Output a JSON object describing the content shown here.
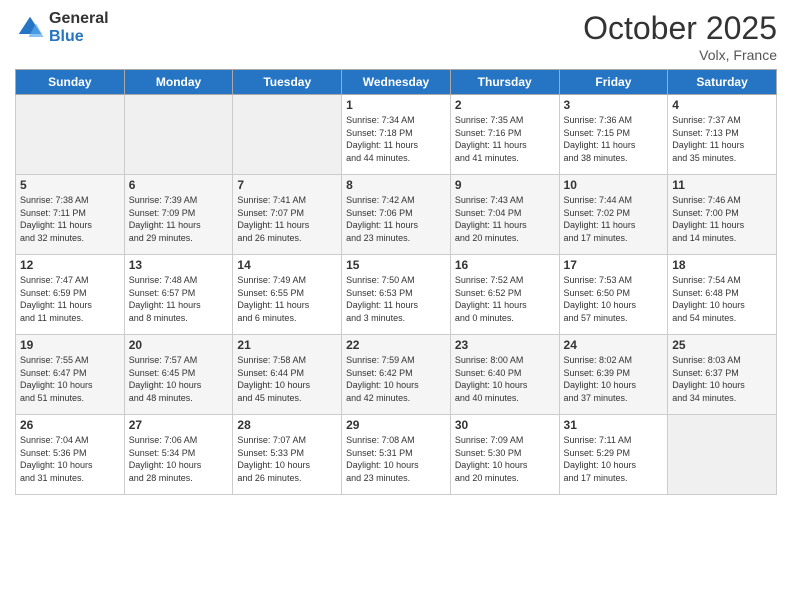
{
  "logo": {
    "general": "General",
    "blue": "Blue"
  },
  "title": "October 2025",
  "subtitle": "Volx, France",
  "weekdays": [
    "Sunday",
    "Monday",
    "Tuesday",
    "Wednesday",
    "Thursday",
    "Friday",
    "Saturday"
  ],
  "weeks": [
    [
      {
        "day": "",
        "info": ""
      },
      {
        "day": "",
        "info": ""
      },
      {
        "day": "",
        "info": ""
      },
      {
        "day": "1",
        "info": "Sunrise: 7:34 AM\nSunset: 7:18 PM\nDaylight: 11 hours\nand 44 minutes."
      },
      {
        "day": "2",
        "info": "Sunrise: 7:35 AM\nSunset: 7:16 PM\nDaylight: 11 hours\nand 41 minutes."
      },
      {
        "day": "3",
        "info": "Sunrise: 7:36 AM\nSunset: 7:15 PM\nDaylight: 11 hours\nand 38 minutes."
      },
      {
        "day": "4",
        "info": "Sunrise: 7:37 AM\nSunset: 7:13 PM\nDaylight: 11 hours\nand 35 minutes."
      }
    ],
    [
      {
        "day": "5",
        "info": "Sunrise: 7:38 AM\nSunset: 7:11 PM\nDaylight: 11 hours\nand 32 minutes."
      },
      {
        "day": "6",
        "info": "Sunrise: 7:39 AM\nSunset: 7:09 PM\nDaylight: 11 hours\nand 29 minutes."
      },
      {
        "day": "7",
        "info": "Sunrise: 7:41 AM\nSunset: 7:07 PM\nDaylight: 11 hours\nand 26 minutes."
      },
      {
        "day": "8",
        "info": "Sunrise: 7:42 AM\nSunset: 7:06 PM\nDaylight: 11 hours\nand 23 minutes."
      },
      {
        "day": "9",
        "info": "Sunrise: 7:43 AM\nSunset: 7:04 PM\nDaylight: 11 hours\nand 20 minutes."
      },
      {
        "day": "10",
        "info": "Sunrise: 7:44 AM\nSunset: 7:02 PM\nDaylight: 11 hours\nand 17 minutes."
      },
      {
        "day": "11",
        "info": "Sunrise: 7:46 AM\nSunset: 7:00 PM\nDaylight: 11 hours\nand 14 minutes."
      }
    ],
    [
      {
        "day": "12",
        "info": "Sunrise: 7:47 AM\nSunset: 6:59 PM\nDaylight: 11 hours\nand 11 minutes."
      },
      {
        "day": "13",
        "info": "Sunrise: 7:48 AM\nSunset: 6:57 PM\nDaylight: 11 hours\nand 8 minutes."
      },
      {
        "day": "14",
        "info": "Sunrise: 7:49 AM\nSunset: 6:55 PM\nDaylight: 11 hours\nand 6 minutes."
      },
      {
        "day": "15",
        "info": "Sunrise: 7:50 AM\nSunset: 6:53 PM\nDaylight: 11 hours\nand 3 minutes."
      },
      {
        "day": "16",
        "info": "Sunrise: 7:52 AM\nSunset: 6:52 PM\nDaylight: 11 hours\nand 0 minutes."
      },
      {
        "day": "17",
        "info": "Sunrise: 7:53 AM\nSunset: 6:50 PM\nDaylight: 10 hours\nand 57 minutes."
      },
      {
        "day": "18",
        "info": "Sunrise: 7:54 AM\nSunset: 6:48 PM\nDaylight: 10 hours\nand 54 minutes."
      }
    ],
    [
      {
        "day": "19",
        "info": "Sunrise: 7:55 AM\nSunset: 6:47 PM\nDaylight: 10 hours\nand 51 minutes."
      },
      {
        "day": "20",
        "info": "Sunrise: 7:57 AM\nSunset: 6:45 PM\nDaylight: 10 hours\nand 48 minutes."
      },
      {
        "day": "21",
        "info": "Sunrise: 7:58 AM\nSunset: 6:44 PM\nDaylight: 10 hours\nand 45 minutes."
      },
      {
        "day": "22",
        "info": "Sunrise: 7:59 AM\nSunset: 6:42 PM\nDaylight: 10 hours\nand 42 minutes."
      },
      {
        "day": "23",
        "info": "Sunrise: 8:00 AM\nSunset: 6:40 PM\nDaylight: 10 hours\nand 40 minutes."
      },
      {
        "day": "24",
        "info": "Sunrise: 8:02 AM\nSunset: 6:39 PM\nDaylight: 10 hours\nand 37 minutes."
      },
      {
        "day": "25",
        "info": "Sunrise: 8:03 AM\nSunset: 6:37 PM\nDaylight: 10 hours\nand 34 minutes."
      }
    ],
    [
      {
        "day": "26",
        "info": "Sunrise: 7:04 AM\nSunset: 5:36 PM\nDaylight: 10 hours\nand 31 minutes."
      },
      {
        "day": "27",
        "info": "Sunrise: 7:06 AM\nSunset: 5:34 PM\nDaylight: 10 hours\nand 28 minutes."
      },
      {
        "day": "28",
        "info": "Sunrise: 7:07 AM\nSunset: 5:33 PM\nDaylight: 10 hours\nand 26 minutes."
      },
      {
        "day": "29",
        "info": "Sunrise: 7:08 AM\nSunset: 5:31 PM\nDaylight: 10 hours\nand 23 minutes."
      },
      {
        "day": "30",
        "info": "Sunrise: 7:09 AM\nSunset: 5:30 PM\nDaylight: 10 hours\nand 20 minutes."
      },
      {
        "day": "31",
        "info": "Sunrise: 7:11 AM\nSunset: 5:29 PM\nDaylight: 10 hours\nand 17 minutes."
      },
      {
        "day": "",
        "info": ""
      }
    ]
  ]
}
